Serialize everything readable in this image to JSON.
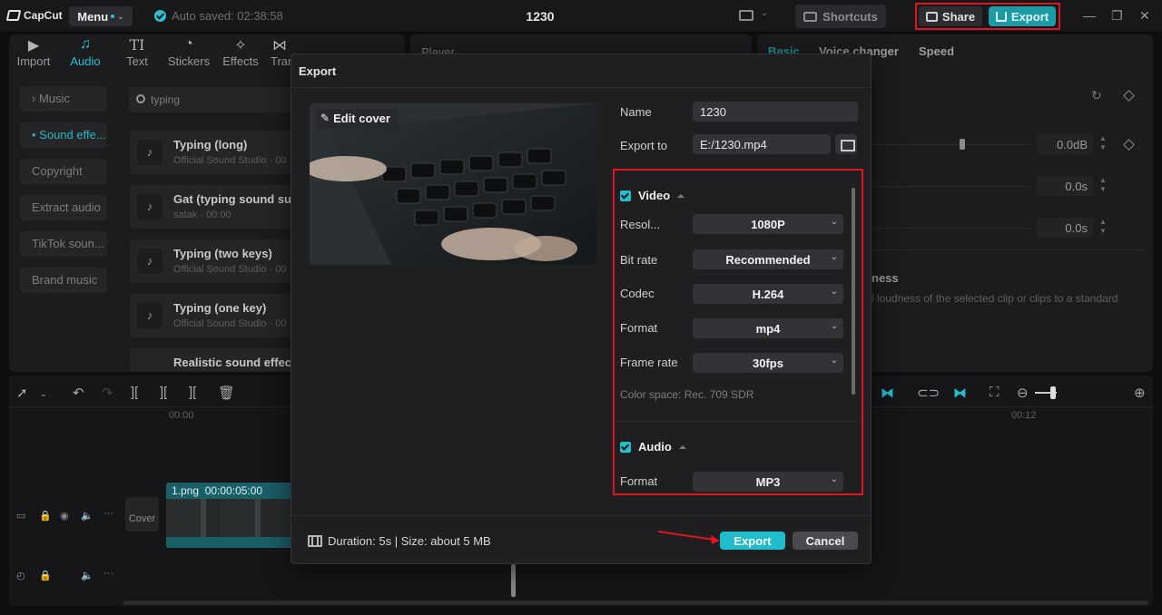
{
  "app": {
    "logo": "CapCut",
    "menu_label": "Menu",
    "autosave": "Auto saved: 02:38:58",
    "project_title": "1230",
    "shortcuts_label": "Shortcuts",
    "share_label": "Share",
    "export_label": "Export"
  },
  "tools": [
    {
      "label": "Import",
      "icon": "import-icon"
    },
    {
      "label": "Audio",
      "icon": "audio-icon"
    },
    {
      "label": "Text",
      "icon": "text-icon"
    },
    {
      "label": "Stickers",
      "icon": "stickers-icon"
    },
    {
      "label": "Effects",
      "icon": "effects-icon"
    },
    {
      "label": "Tran",
      "icon": "transitions-icon"
    }
  ],
  "sidebar": {
    "items": [
      "Music",
      "Sound effe...",
      "Copyright",
      "Extract audio",
      "TikTok soun...",
      "Brand music"
    ]
  },
  "search": {
    "value": "typing"
  },
  "sounds": [
    {
      "title": "Typing (long)",
      "sub": "Official Sound Studio · 00"
    },
    {
      "title": "Gat (typing sound su",
      "sub": "satak · 00:00"
    },
    {
      "title": "Typing (two keys)",
      "sub": "Official Sound Studio · 00"
    },
    {
      "title": "Typing (one key)",
      "sub": "Official Sound Studio · 00"
    },
    {
      "title": "Realistic sound effect",
      "sub": ""
    }
  ],
  "player": {
    "label": "Player"
  },
  "right_panel": {
    "tabs": [
      "Basic",
      "Voice changer",
      "Speed"
    ],
    "volume": "0.0dB",
    "fade_in": "0.0s",
    "fade_out": "0.0s",
    "loudness_title": "ness",
    "loudness_desc": "l loudness of the selected clip or clips to a standard"
  },
  "timeline": {
    "time_start": "00:00",
    "time_end": "00:12",
    "clip_name": "1.png",
    "clip_duration": "00:00:05:00",
    "cover_label": "Cover"
  },
  "export_dialog": {
    "title": "Export",
    "edit_cover": "Edit cover",
    "name_label": "Name",
    "name_value": "1230",
    "export_to_label": "Export to",
    "export_to_value": "E:/1230.mp4",
    "video": {
      "label": "Video",
      "resolution_label": "Resol...",
      "resolution": "1080P",
      "bitrate_label": "Bit rate",
      "bitrate": "Recommended",
      "codec_label": "Codec",
      "codec": "H.264",
      "format_label": "Format",
      "format": "mp4",
      "framerate_label": "Frame rate",
      "framerate": "30fps",
      "colorspace": "Color space: Rec. 709 SDR"
    },
    "audio": {
      "label": "Audio",
      "format_label": "Format",
      "format": "MP3"
    },
    "duration_info": "Duration: 5s | Size: about 5 MB",
    "export_button": "Export",
    "cancel_button": "Cancel"
  },
  "colors": {
    "accent": "#1fbccb",
    "annotation_red": "#e0141c",
    "background": "#0e0e10",
    "panel": "#1c1c1f"
  }
}
